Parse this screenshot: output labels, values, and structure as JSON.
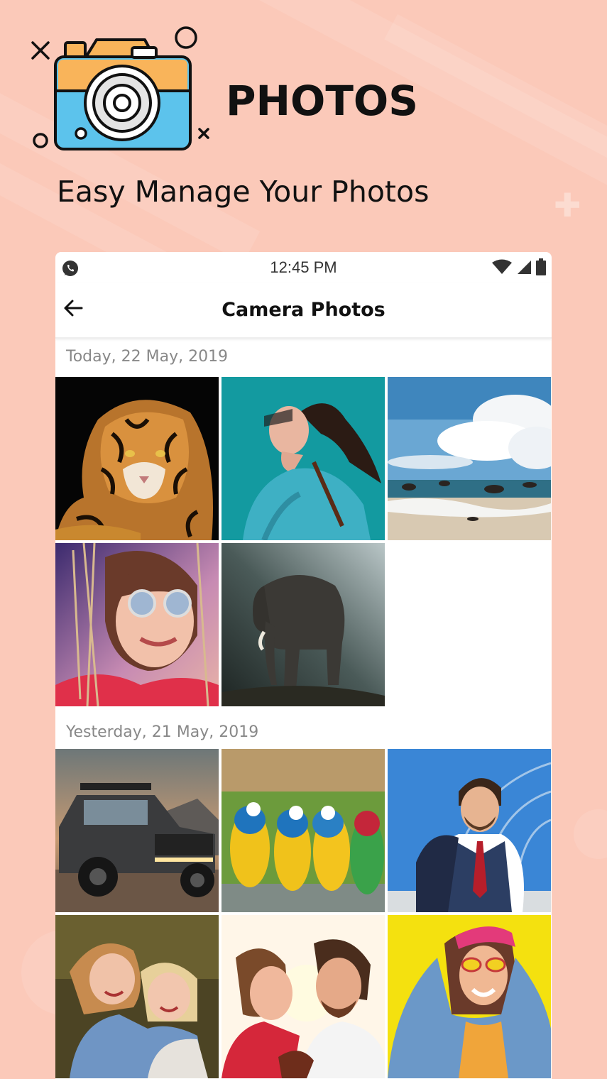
{
  "header": {
    "brand": "PHOTOS",
    "tagline": "Easy Manage Your Photos"
  },
  "status_bar": {
    "time": "12:45 PM",
    "left_icon": "whatsapp-icon",
    "right_icons": [
      "wifi-icon",
      "signal-icon",
      "battery-icon"
    ]
  },
  "app_bar": {
    "title": "Camera Photos",
    "back_icon": "arrow-left-icon"
  },
  "sections": [
    {
      "date": "Today, 22 May, 2019",
      "photos": [
        "tiger",
        "woman-in-teal-jacket",
        "beach-clouds",
        "woman-sunglasses",
        "elephant"
      ]
    },
    {
      "date": "Yesterday, 21 May, 2019",
      "photos": [
        "pickup-truck",
        "parrots",
        "man-in-vest",
        "two-girls-hugging",
        "couple-sunset",
        "woman-yellow-wall"
      ]
    }
  ],
  "colors": {
    "background": "#fbc9b9",
    "card": "#ffffff",
    "camera_orange": "#f9b45a",
    "camera_blue": "#5cc3ec"
  }
}
